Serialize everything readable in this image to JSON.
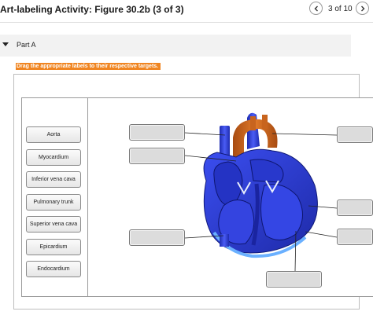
{
  "header": {
    "title": "Art-labeling Activity: Figure 30.2b (3 of 3)",
    "counter": "3 of 10",
    "prev_icon": "chevron-left-icon",
    "next_icon": "chevron-right-icon"
  },
  "part": {
    "label": "Part A",
    "caret_icon": "caret-down-icon"
  },
  "instruction": "Drag the appropriate labels to their respective targets.",
  "label_bank": [
    "Aorta",
    "Myocardium",
    "Inferior vena cava",
    "Pulmonary trunk",
    "Superior vena cava",
    "Epicardium",
    "Endocardium"
  ],
  "colors": {
    "accent": "#f08521",
    "heart_blue": "#2f3fd6",
    "vessel_orange": "#c8641e"
  }
}
